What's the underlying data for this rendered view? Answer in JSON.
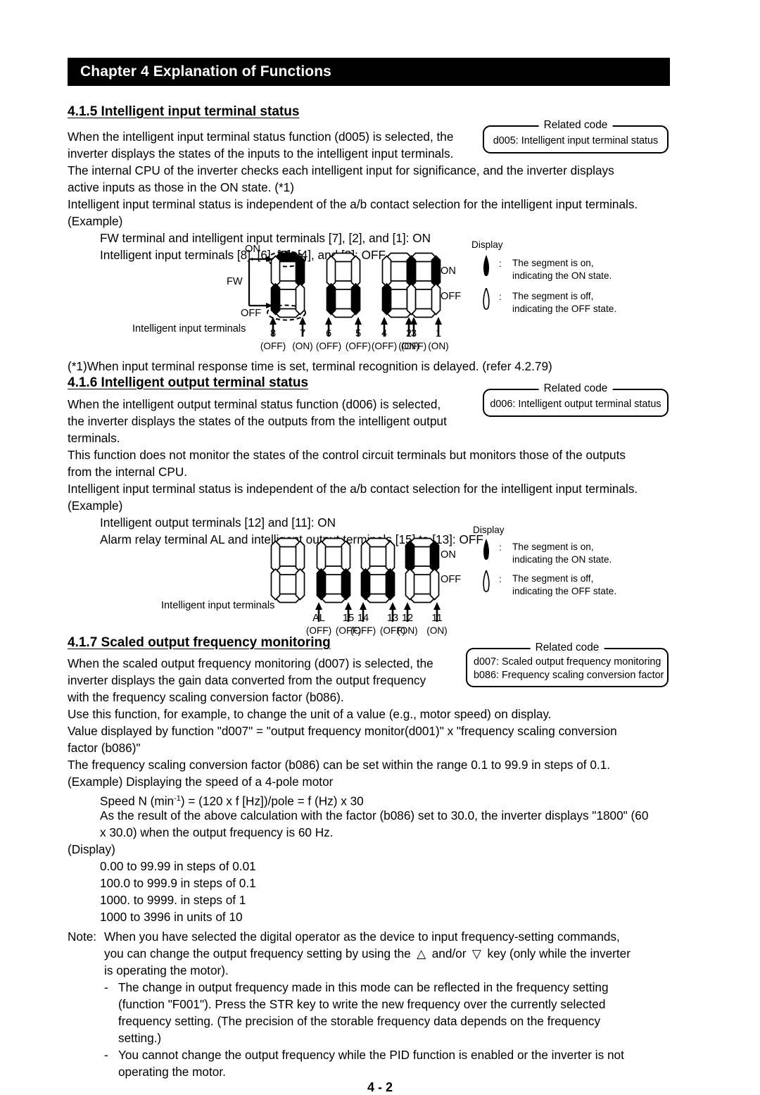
{
  "header": {
    "chapter_title": "Chapter 4 Explanation of Functions"
  },
  "page_number": "4 - 2",
  "sections": [
    {
      "id": "4.1.5",
      "heading": "4.1.5 Intelligent input terminal status",
      "related_code": {
        "title": "Related code",
        "lines": [
          "d005: Intelligent input terminal status"
        ]
      },
      "paragraphs": [
        "When the intelligent input terminal status function (d005) is selected, the",
        "inverter displays the states of the inputs to the intelligent input terminals.",
        "The internal CPU of the inverter checks each intelligent input for significance, and the inverter displays",
        "active inputs as those in the ON state. (*1)",
        "Intelligent input terminal status is independent of the a/b contact selection for the intelligent input terminals.",
        "(Example)",
        "FW terminal and intelligent input terminals [7], [2], and [1]: ON",
        "Intelligent input terminals [8], [6], [5], [4], and [3]: OFF"
      ],
      "footnote": "(*1)When input terminal response time is set, terminal recognition is delayed. (refer 4.2.79)"
    },
    {
      "id": "4.1.6",
      "heading": "4.1.6 Intelligent output terminal status",
      "related_code": {
        "title": "Related code",
        "lines": [
          "d006: Intelligent output terminal status"
        ]
      },
      "paragraphs": [
        "When the intelligent output terminal status function (d006) is selected,",
        "the inverter displays the states of the outputs from the intelligent output",
        "terminals.",
        "This function does not monitor the states of the control circuit terminals but monitors those of the outputs",
        "from the internal CPU.",
        "Intelligent input terminal status is independent of the a/b contact selection for the intelligent input terminals.",
        "(Example)",
        "Intelligent output terminals [12] and [11]: ON",
        "Alarm relay terminal AL and intelligent output terminals [15] to [13]: OFF"
      ]
    },
    {
      "id": "4.1.7",
      "heading": "4.1.7 Scaled output frequency monitoring",
      "related_code": {
        "title": "Related code",
        "lines": [
          "d007: Scaled output frequency monitoring",
          "b086: Frequency scaling conversion factor"
        ]
      },
      "paragraphs": [
        "When the scaled output frequency monitoring (d007) is selected, the",
        "inverter displays the gain data converted from the output frequency",
        "with the frequency scaling conversion factor (b086).",
        "Use this function, for example, to change the unit of a value (e.g., motor speed) on display.",
        "Value displayed by function \"d007\" = \"output frequency monitor(d001)\" x \"frequency scaling conversion",
        "factor (b086)\"",
        "The frequency scaling conversion factor (b086) can be set within the range 0.1 to 99.9 in steps of 0.1.",
        "(Example) Displaying the speed of a 4-pole motor",
        "Speed N (min",
        ") = (120 x f [Hz])/pole = f (Hz) x 30",
        "As the result of the above calculation with the factor (b086) set to 30.0, the inverter displays \"1800\" (60",
        "x 30.0) when the output frequency is 60 Hz.",
        "(Display)"
      ],
      "speed_exponent": "-1",
      "display_ranges": [
        "0.00 to 99.99 in steps of 0.01",
        "100.0 to 999.9 in steps of 0.1",
        "1000. to 9999. in steps of 1",
        "1000 to 3996 in units of 10"
      ],
      "note": {
        "label": "Note:",
        "lines": [
          "When you have selected the digital operator as the device to input frequency-setting commands,",
          "you can change the output frequency setting by using the",
          "and/or",
          "key (only while the inverter",
          "is operating the motor)."
        ],
        "up_key_icon": "triangle-up-icon",
        "down_key_icon": "triangle-down-icon",
        "bullets": [
          [
            "The change in output frequency made in this mode can be reflected in the frequency setting",
            "(function \"F001\"). Press the STR key to write the new frequency over the currently selected",
            "frequency setting. (The precision of the storable frequency data depends on the frequency",
            "setting.)"
          ],
          [
            "You cannot change the output frequency while the PID function is enabled or the inverter is not",
            "operating the motor."
          ]
        ]
      }
    }
  ],
  "diagram_input": {
    "display_label": "Display",
    "fw_label": "FW",
    "on_label": "ON",
    "off_label": "OFF",
    "terminals_label": "Intelligent input terminals",
    "row_on_label": "ON",
    "row_off_label": "OFF",
    "terminal_numbers": [
      "8",
      "7",
      "6",
      "5",
      "4",
      "3",
      "2",
      "1"
    ],
    "terminal_states": [
      "(OFF)",
      "(ON)",
      "(OFF)",
      "(OFF)",
      "(OFF)",
      "(OFF)",
      "(ON)",
      "(ON)"
    ],
    "digits": [
      {
        "top": true,
        "ul": false,
        "ur": true,
        "mid": false,
        "ll": true,
        "lr": false,
        "bot": false
      },
      {
        "top": false,
        "ul": false,
        "ur": false,
        "mid": false,
        "ll": true,
        "lr": true,
        "bot": false
      },
      {
        "top": false,
        "ul": false,
        "ur": false,
        "mid": false,
        "ll": true,
        "lr": true,
        "bot": false
      },
      {
        "top": false,
        "ul": true,
        "ur": true,
        "mid": false,
        "ll": false,
        "lr": false,
        "bot": false
      }
    ],
    "legend": {
      "on_icon": "segment-on-icon",
      "on_text_line1": "The segment is on,",
      "on_text_line2": "indicating the ON state.",
      "off_icon": "segment-off-icon",
      "off_text_line1": "The segment is off,",
      "off_text_line2": "indicating the OFF state.",
      "colon": ":"
    }
  },
  "diagram_output": {
    "display_label": "Display",
    "terminals_label": "Intelligent input terminals",
    "row_on_label": "ON",
    "row_off_label": "OFF",
    "terminal_numbers": [
      "AL",
      "15",
      "14",
      "13",
      "12",
      "11"
    ],
    "terminal_states": [
      "(OFF)",
      "(OFF)",
      "(OFF)",
      "(OFF)",
      "(ON)",
      "(ON)"
    ],
    "digits": [
      {
        "top": false,
        "ul": false,
        "ur": false,
        "mid": false,
        "ll": false,
        "lr": false,
        "bot": false
      },
      {
        "top": false,
        "ul": false,
        "ur": false,
        "mid": false,
        "ll": true,
        "lr": true,
        "bot": false
      },
      {
        "top": false,
        "ul": false,
        "ur": false,
        "mid": false,
        "ll": true,
        "lr": true,
        "bot": false
      },
      {
        "top": false,
        "ul": true,
        "ur": true,
        "mid": false,
        "ll": false,
        "lr": false,
        "bot": false
      }
    ],
    "legend": {
      "on_icon": "segment-on-icon",
      "on_text_line1": "The segment is on,",
      "on_text_line2": "indicating the ON state.",
      "off_icon": "segment-off-icon",
      "off_text_line1": "The segment is off,",
      "off_text_line2": "indicating the OFF state.",
      "colon": ":"
    }
  }
}
